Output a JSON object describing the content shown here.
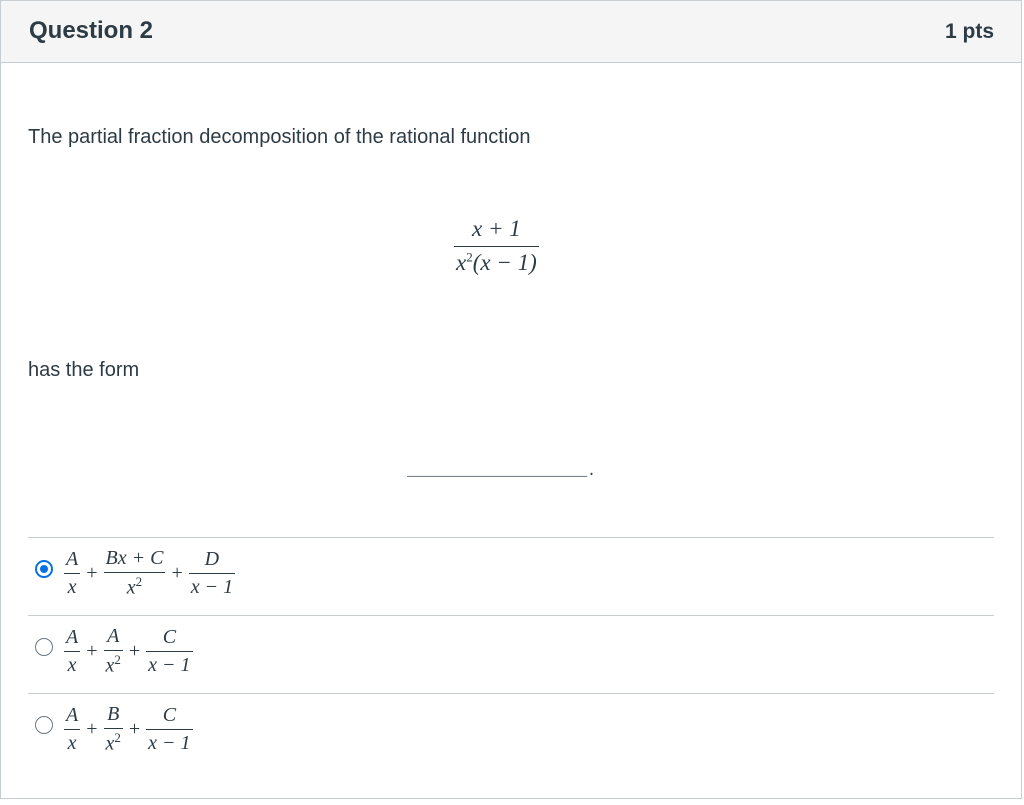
{
  "question": {
    "title": "Question 2",
    "points": "1 pts",
    "prompt": "The partial fraction decomposition of the rational function",
    "function": {
      "numerator": "x + 1",
      "denominator_base": "x",
      "denominator_exp": "2",
      "denominator_factor": "(x − 1)"
    },
    "form_text": "has the form",
    "blank": "____________________."
  },
  "answers": [
    {
      "selected": true,
      "terms": [
        {
          "num": "A",
          "den": "x"
        },
        {
          "num": "Bx + C",
          "den": "x",
          "den_exp": "2"
        },
        {
          "num": "D",
          "den": "x − 1"
        }
      ]
    },
    {
      "selected": false,
      "terms": [
        {
          "num": "A",
          "den": "x"
        },
        {
          "num": "A",
          "den": "x",
          "den_exp": "2"
        },
        {
          "num": "C",
          "den": "x − 1"
        }
      ]
    },
    {
      "selected": false,
      "terms": [
        {
          "num": "A",
          "den": "x"
        },
        {
          "num": "B",
          "den": "x",
          "den_exp": "2"
        },
        {
          "num": "C",
          "den": "x − 1"
        }
      ]
    }
  ],
  "operator": "+",
  "colors": {
    "accent": "#0770e6",
    "text": "#2d3b45",
    "border": "#c7cdd1",
    "header_bg": "#f5f5f5"
  }
}
